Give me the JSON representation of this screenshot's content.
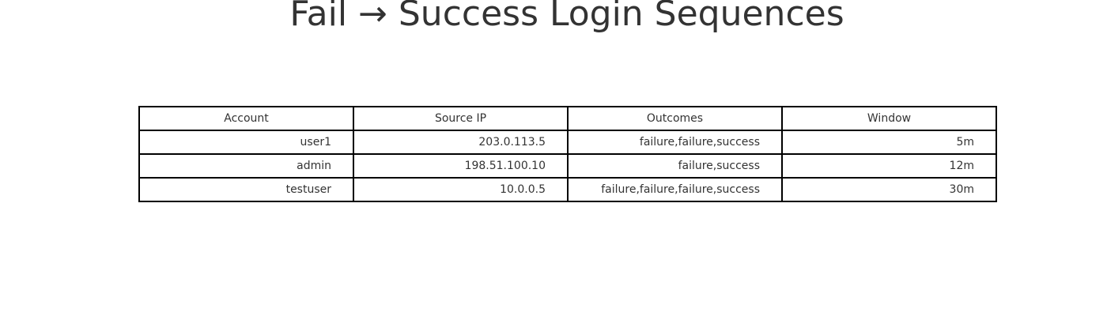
{
  "title": "Fail → Success Login Sequences",
  "chart_data": {
    "type": "table",
    "title": "Fail → Success Login Sequences",
    "columns": [
      "Account",
      "Source IP",
      "Outcomes",
      "Window"
    ],
    "rows": [
      [
        "user1",
        "203.0.113.5",
        "failure,failure,success",
        "5m"
      ],
      [
        "admin",
        "198.51.100.10",
        "failure,success",
        "12m"
      ],
      [
        "testuser",
        "10.0.0.5",
        "failure,failure,failure,success",
        "30m"
      ]
    ]
  }
}
